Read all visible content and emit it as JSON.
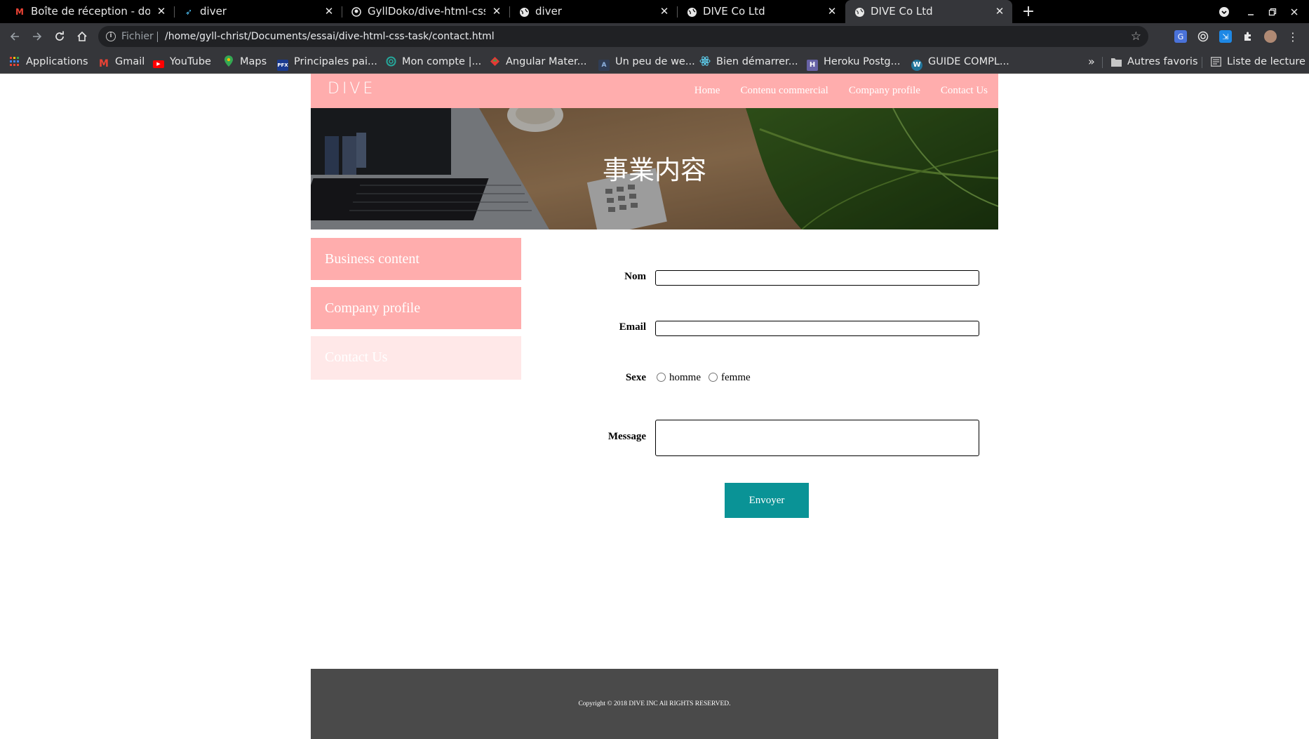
{
  "browser": {
    "tabs": [
      {
        "title": "Boîte de réception - doko",
        "icon": "gmail-icon",
        "active": false
      },
      {
        "title": "diver",
        "icon": "rocket-icon",
        "active": false
      },
      {
        "title": "GyllDoko/dive-html-css-ta",
        "icon": "github-icon",
        "active": false
      },
      {
        "title": "diver",
        "icon": "globe-icon",
        "active": false
      },
      {
        "title": "DIVE Co Ltd",
        "icon": "globe-icon",
        "active": false
      },
      {
        "title": "DIVE Co Ltd",
        "icon": "globe-icon",
        "active": true
      }
    ],
    "close_glyph": "✕",
    "new_tab_glyph": "+",
    "address": {
      "scheme": "Fichier",
      "url": "/home/gyll-christ/Documents/essai/dive-html-css-task/contact.html"
    },
    "bookmarks": [
      {
        "label": "Applications",
        "icon": "apps-grid-icon",
        "color": "#4285f4"
      },
      {
        "label": "Gmail",
        "icon": "gmail-icon",
        "color": "#ea4335"
      },
      {
        "label": "YouTube",
        "icon": "youtube-icon",
        "color": "#ff0000"
      },
      {
        "label": "Maps",
        "icon": "maps-pin-icon",
        "color": "#34a853"
      },
      {
        "label": "Principales pai...",
        "icon": "pfx-icon",
        "color": "#1a3a8f"
      },
      {
        "label": "Mon compte |...",
        "icon": "swirl-icon",
        "color": "#26a69a"
      },
      {
        "label": "Angular Mater...",
        "icon": "angular-icon",
        "color": "#e53935"
      },
      {
        "label": "Un peu de we...",
        "icon": "tutorial-icon",
        "color": "#5c7aa8"
      },
      {
        "label": "Bien démarrer...",
        "icon": "react-icon",
        "color": "#61dafb"
      },
      {
        "label": "Heroku Postg...",
        "icon": "heroku-icon",
        "color": "#6762a6"
      },
      {
        "label": "GUIDE COMPL...",
        "icon": "wordpress-icon",
        "color": "#21759b"
      }
    ],
    "more_bookmarks": "»",
    "other_bookmarks": "Autres favoris",
    "reading_list": "Liste de lecture"
  },
  "site": {
    "logo": "DIVE",
    "nav": [
      "Home",
      "Contenu commercial",
      "Company profile",
      "Contact Us"
    ],
    "hero_title": "事業内容",
    "sidebar": [
      {
        "label": "Business content",
        "active": false
      },
      {
        "label": "Company profile",
        "active": false
      },
      {
        "label": "Contact Us",
        "active": true
      }
    ],
    "form": {
      "name_label": "Nom",
      "name_value": "",
      "email_label": "Email",
      "email_value": "",
      "sex_label": "Sexe",
      "sex_options": [
        "homme",
        "femme"
      ],
      "message_label": "Message",
      "message_value": "",
      "submit_label": "Envoyer"
    },
    "footer": "Copyright © 2018 DIVE INC All RIGHTS RESERVED.",
    "colors": {
      "header_pink": "#ffadad",
      "sidebar_active": "#ffe8e8",
      "submit_teal": "#0a9396",
      "footer_gray": "#4a4a4a"
    }
  }
}
